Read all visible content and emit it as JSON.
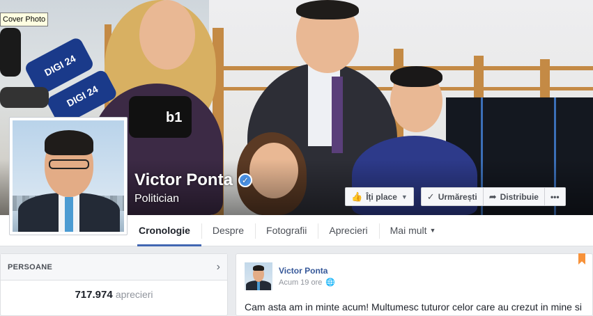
{
  "tooltip": {
    "text": "Cover Photo"
  },
  "cover": {
    "mic_labels": [
      "DIGI 24",
      "DIGI 24",
      "b1"
    ]
  },
  "page": {
    "name": "Victor Ponta",
    "category": "Politician",
    "verified": true
  },
  "actions": {
    "like_label": "Îți place",
    "follow_label": "Urmărești",
    "share_label": "Distribuie",
    "more_label": "•••"
  },
  "tabs": [
    {
      "label": "Cronologie",
      "active": true
    },
    {
      "label": "Despre",
      "active": false
    },
    {
      "label": "Fotografii",
      "active": false
    },
    {
      "label": "Aprecieri",
      "active": false
    },
    {
      "label": "Mai mult",
      "active": false
    }
  ],
  "people_card": {
    "title": "PERSOANE",
    "likes_count": "717.974",
    "likes_label": "aprecieri"
  },
  "post": {
    "author": "Victor Ponta",
    "time": "Acum 19 ore",
    "text": "Cam asta am in minte acum! Multumesc tuturor celor care au crezut in mine si"
  },
  "colors": {
    "accent": "#4267b2",
    "link": "#365899",
    "bookmark": "#f7923a"
  }
}
